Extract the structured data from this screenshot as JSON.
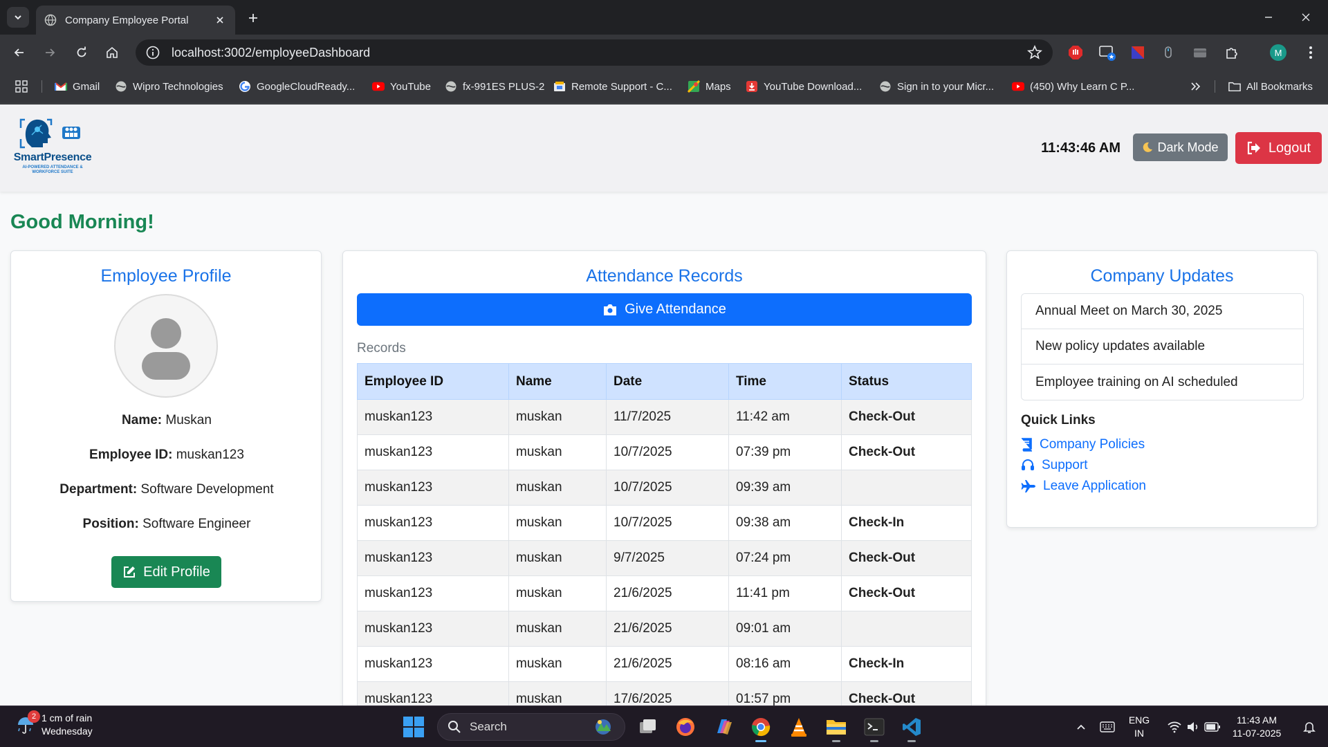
{
  "browser": {
    "tab_title": "Company Employee Portal",
    "url": "localhost:3002/employeeDashboard",
    "profile_initial": "M",
    "bookmarks": [
      {
        "label": "Gmail",
        "icon": "gmail-icon"
      },
      {
        "label": "Wipro Technologies",
        "icon": "globe-icon"
      },
      {
        "label": "GoogleCloudReady...",
        "icon": "google-icon"
      },
      {
        "label": "YouTube",
        "icon": "youtube-icon"
      },
      {
        "label": "fx-991ES PLUS-2",
        "icon": "globe-icon"
      },
      {
        "label": "Remote Support - C...",
        "icon": "remote-support-icon"
      },
      {
        "label": "Maps",
        "icon": "maps-icon"
      },
      {
        "label": "YouTube Download...",
        "icon": "download-icon"
      },
      {
        "label": "Sign in to your Micr...",
        "icon": "globe-icon"
      },
      {
        "label": "(450) Why Learn C P...",
        "icon": "youtube-icon"
      }
    ],
    "all_bookmarks_label": "All Bookmarks"
  },
  "header": {
    "logo_text": "SmartPresence",
    "logo_subtext": "AI-POWERED ATTENDANCE & WORKFORCE SUITE",
    "clock": "11:43:46 AM",
    "dark_mode_label": "Dark Mode",
    "logout_label": "Logout"
  },
  "greeting": "Good Morning!",
  "profile": {
    "title": "Employee Profile",
    "fields": [
      {
        "label": "Name:",
        "value": "Muskan"
      },
      {
        "label": "Employee ID:",
        "value": "muskan123"
      },
      {
        "label": "Department:",
        "value": "Software Development"
      },
      {
        "label": "Position:",
        "value": "Software Engineer"
      }
    ],
    "edit_label": "Edit Profile"
  },
  "attendance": {
    "title": "Attendance Records",
    "give_label": "Give Attendance",
    "records_label": "Records",
    "columns": [
      "Employee ID",
      "Name",
      "Date",
      "Time",
      "Status"
    ],
    "rows": [
      {
        "id": "muskan123",
        "name": "muskan",
        "date": "11/7/2025",
        "time": "11:42 am",
        "status": "Check-Out"
      },
      {
        "id": "muskan123",
        "name": "muskan",
        "date": "10/7/2025",
        "time": "07:39 pm",
        "status": "Check-Out"
      },
      {
        "id": "muskan123",
        "name": "muskan",
        "date": "10/7/2025",
        "time": "09:39 am",
        "status": ""
      },
      {
        "id": "muskan123",
        "name": "muskan",
        "date": "10/7/2025",
        "time": "09:38 am",
        "status": "Check-In"
      },
      {
        "id": "muskan123",
        "name": "muskan",
        "date": "9/7/2025",
        "time": "07:24 pm",
        "status": "Check-Out"
      },
      {
        "id": "muskan123",
        "name": "muskan",
        "date": "21/6/2025",
        "time": "11:41 pm",
        "status": "Check-Out"
      },
      {
        "id": "muskan123",
        "name": "muskan",
        "date": "21/6/2025",
        "time": "09:01 am",
        "status": ""
      },
      {
        "id": "muskan123",
        "name": "muskan",
        "date": "21/6/2025",
        "time": "08:16 am",
        "status": "Check-In"
      },
      {
        "id": "muskan123",
        "name": "muskan",
        "date": "17/6/2025",
        "time": "01:57 pm",
        "status": "Check-Out"
      }
    ]
  },
  "updates": {
    "title": "Company Updates",
    "items": [
      "Annual Meet on March 30, 2025",
      "New policy updates available",
      "Employee training on AI scheduled"
    ],
    "quick_links_title": "Quick Links",
    "quick_links": [
      {
        "label": "Company Policies",
        "icon": "book-icon"
      },
      {
        "label": "Support",
        "icon": "headset-icon"
      },
      {
        "label": "Leave Application",
        "icon": "plane-icon"
      }
    ]
  },
  "taskbar": {
    "weather_badge": "2",
    "weather_line1": "1 cm of rain",
    "weather_line2": "Wednesday",
    "search_label": "Search",
    "lang_line1": "ENG",
    "lang_line2": "IN",
    "time": "11:43 AM",
    "date": "11-07-2025"
  },
  "colors": {
    "primary": "#0d6efd",
    "success": "#198754",
    "danger": "#dc3545",
    "secondary": "#6c757d",
    "title_blue": "#1a73e8"
  }
}
